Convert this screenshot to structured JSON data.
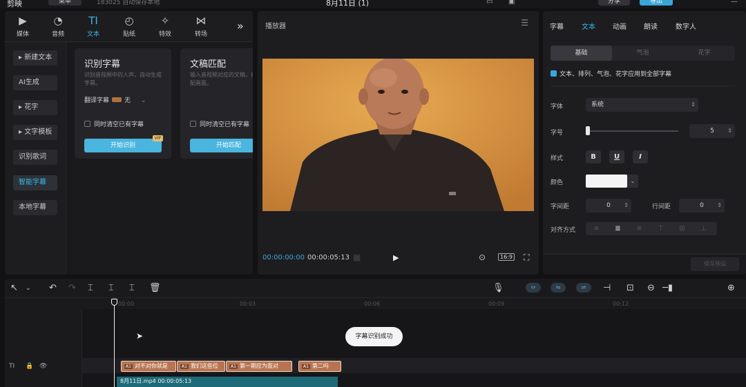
{
  "topbar": {
    "logo": "剪映",
    "menu": "菜单",
    "project": "183025 自动保存本地",
    "title": "8月11日 (1)",
    "share": "分享",
    "export": "导出"
  },
  "tool_tabs": [
    {
      "label": "媒体",
      "icon": "media-icon"
    },
    {
      "label": "音频",
      "icon": "audio-icon"
    },
    {
      "label": "文本",
      "icon": "text-icon"
    },
    {
      "label": "贴纸",
      "icon": "sticker-icon"
    },
    {
      "label": "特效",
      "icon": "effects-icon"
    },
    {
      "label": "转场",
      "icon": "transition-icon"
    }
  ],
  "side_nav": [
    {
      "label": "新建文本",
      "arrow": true
    },
    {
      "label": "AI生成",
      "arrow": false
    },
    {
      "label": "花字",
      "arrow": true
    },
    {
      "label": "文字模板",
      "arrow": true
    },
    {
      "label": "识别歌词",
      "arrow": false
    },
    {
      "label": "智能字幕",
      "arrow": false
    },
    {
      "label": "本地字幕",
      "arrow": false
    }
  ],
  "cards": {
    "recognize": {
      "title": "识别字幕",
      "desc": "识别音视频中的人声，自动生成字幕。",
      "translate_label": "翻译字幕",
      "translate_value": "无",
      "clear_label": "同时清空已有字幕",
      "button": "开始识别",
      "vip": "VIP"
    },
    "match": {
      "title": "文稿匹配",
      "desc": "输入音视频对应的文稿，自动匹配画面。",
      "clear_label": "同时清空已有字幕",
      "button": "开始匹配"
    }
  },
  "player": {
    "title": "播放器",
    "time_current": "00:00:00:00",
    "time_total": "00:00:05:13",
    "ratio": "16:9"
  },
  "props": {
    "tabs": [
      "字幕",
      "文本",
      "动画",
      "朗读",
      "数字人"
    ],
    "segments": [
      "基础",
      "气泡",
      "花字"
    ],
    "apply_all": "文本、排列、气泡、花字应用到全部字幕",
    "font_label": "字体",
    "font_value": "系统",
    "size_label": "字号",
    "size_value": "5",
    "size_fraction": 0.0,
    "style_label": "样式",
    "style_buttons": [
      "B",
      "U",
      "I"
    ],
    "color_label": "颜色",
    "color_value": "#f5f5f5",
    "char_spacing_label": "字间距",
    "char_spacing_value": "0",
    "line_spacing_label": "行间距",
    "line_spacing_value": "0",
    "align_label": "对齐方式",
    "save_preset": "保存预设"
  },
  "timeline": {
    "ticks": [
      "00:00",
      "00:03",
      "00:06",
      "00:09",
      "00:12"
    ],
    "clips": [
      {
        "tag": "A1",
        "text": "对不对你就是"
      },
      {
        "tag": "A1",
        "text": "我们这些位"
      },
      {
        "tag": "A1",
        "text": "第一期应为面对"
      },
      {
        "tag": "A1",
        "text": "第二吗"
      }
    ],
    "video_clip": "8月11日.mp4  00:00:05:13",
    "toast": "字幕识别成功"
  },
  "colors": {
    "accent": "#38b5e8",
    "clip": "#b87450",
    "video_clip": "#1e6a78"
  }
}
